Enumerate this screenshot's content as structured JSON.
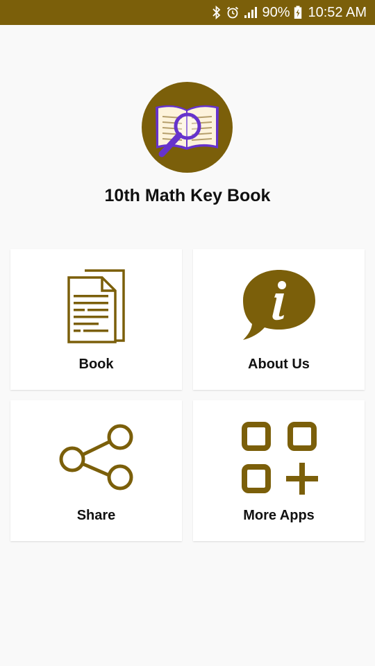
{
  "status_bar": {
    "battery": "90%",
    "time": "10:52 AM",
    "icons": [
      "bluetooth-icon",
      "alarm-icon",
      "signal-icon",
      "battery-charging-icon"
    ]
  },
  "app": {
    "title": "10th Math Key Book",
    "logo_icon": "open-book-magnifier-icon"
  },
  "menu": {
    "book": {
      "label": "Book",
      "icon": "document-icon"
    },
    "about": {
      "label": "About Us",
      "icon": "info-speech-bubble-icon"
    },
    "share": {
      "label": "Share",
      "icon": "share-icon"
    },
    "more_apps": {
      "label": "More Apps",
      "icon": "apps-grid-plus-icon"
    }
  },
  "colors": {
    "brand": "#7b5f0a",
    "background": "#f9f9f9",
    "card": "#ffffff",
    "text": "#111111",
    "logo_accent": "#6633cc"
  }
}
